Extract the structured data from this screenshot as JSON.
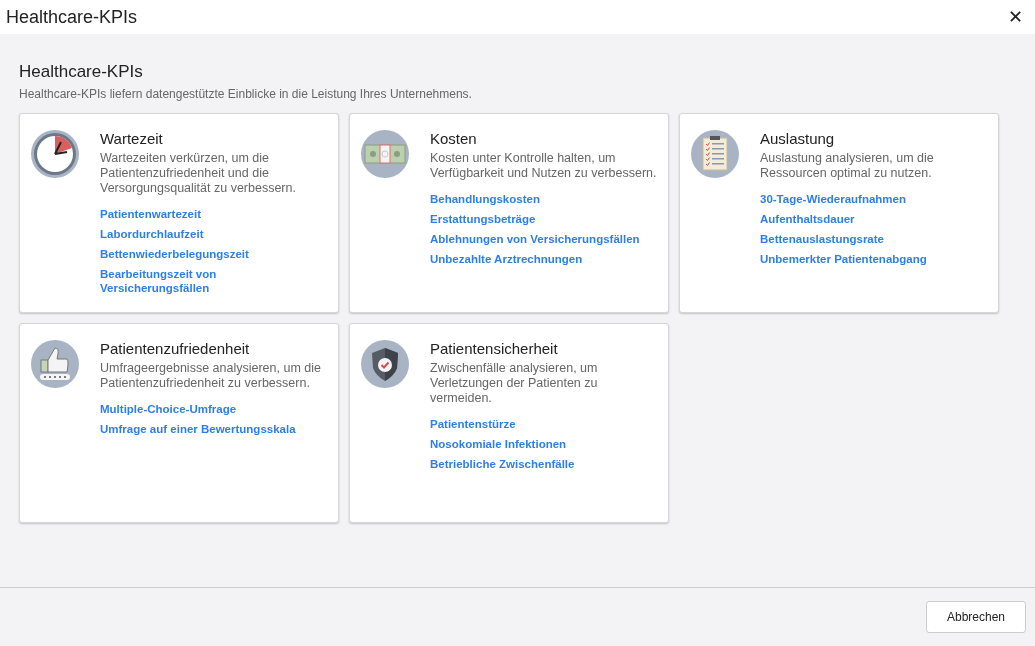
{
  "window": {
    "title": "Healthcare-KPIs",
    "close": "✕"
  },
  "section": {
    "title": "Healthcare-KPIs",
    "description": "Healthcare-KPIs liefern datengestützte Einblicke in die Leistung Ihres Unternehmens."
  },
  "cards": [
    {
      "title": "Wartezeit",
      "description": "Wartezeiten verkürzen, um die Patientenzufriedenheit und die Versorgungsqualität zu verbessern.",
      "links": [
        "Patientenwartezeit",
        "Labordurchlaufzeit",
        "Bettenwiederbelegungszeit",
        "Bearbeitungszeit von Versicherungsfällen"
      ]
    },
    {
      "title": "Kosten",
      "description": "Kosten unter Kontrolle halten, um Verfügbarkeit und Nutzen zu verbessern.",
      "links": [
        "Behandlungskosten",
        "Erstattungsbeträge",
        "Ablehnungen von Versicherungsfällen",
        "Unbezahlte Arztrechnungen"
      ]
    },
    {
      "title": "Auslastung",
      "description": "Auslastung analysieren, um die Ressourcen optimal zu nutzen.",
      "links": [
        "30-Tage-Wiederaufnahmen",
        "Aufenthaltsdauer",
        "Bettenauslastungsrate",
        "Unbemerkter Patientenabgang"
      ]
    },
    {
      "title": "Patientenzufriedenheit",
      "description": "Umfrageergebnisse analysieren, um die Patientenzufriedenheit zu verbessern.",
      "links": [
        "Multiple-Choice-Umfrage",
        "Umfrage auf einer Bewertungsskala"
      ]
    },
    {
      "title": "Patientensicherheit",
      "description": "Zwischenfälle analysieren, um Verletzungen der Patienten zu vermeiden.",
      "links": [
        "Patientenstürze",
        "Nosokomiale Infektionen",
        "Betriebliche Zwischenfälle"
      ]
    }
  ],
  "footer": {
    "cancel_button": "Abbrechen"
  }
}
